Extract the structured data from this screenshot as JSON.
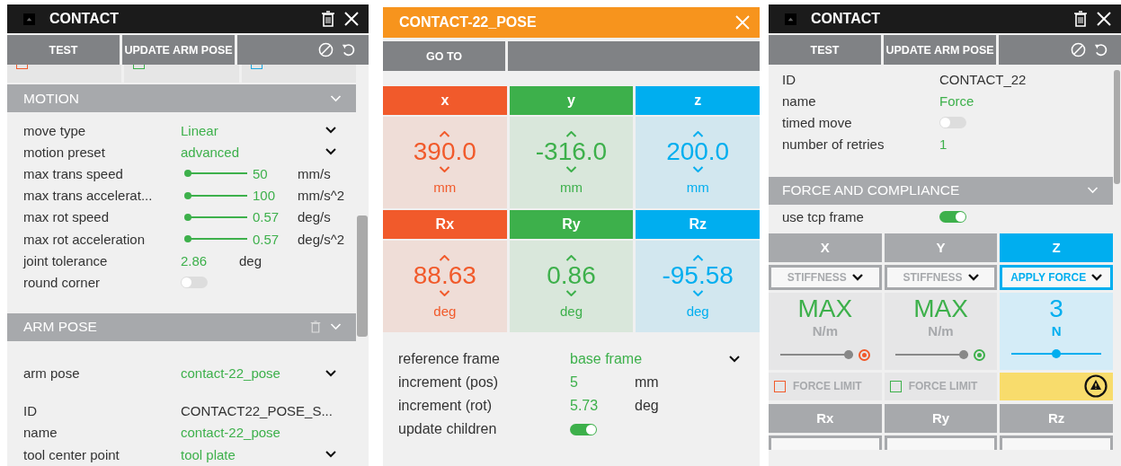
{
  "left_panel": {
    "title": "CONTACT",
    "buttons": [
      "TEST",
      "UPDATE ARM POSE"
    ],
    "limit_strip": [
      {
        "color": "#f15a2b",
        "checked": false
      },
      {
        "color": "#3db04b",
        "checked": false
      },
      {
        "color": "#1ea7e0",
        "checked": false
      }
    ],
    "motion": {
      "title": "MOTION",
      "rows": [
        {
          "kind": "dropdown",
          "label": "move type",
          "value": "Linear"
        },
        {
          "kind": "dropdown",
          "label": "motion preset",
          "value": "advanced"
        },
        {
          "kind": "slider",
          "label": "max trans speed",
          "level": 0,
          "value": "50",
          "unit": "mm/s"
        },
        {
          "kind": "slider",
          "label": "max trans accelerat...",
          "level": 0,
          "value": "100",
          "unit": "mm/s^2"
        },
        {
          "kind": "slider",
          "label": "max rot speed",
          "level": 0,
          "value": "0.57",
          "unit": "deg/s"
        },
        {
          "kind": "slider",
          "label": "max rot acceleration",
          "level": 0,
          "value": "0.57",
          "unit": "deg/s^2"
        },
        {
          "kind": "number",
          "label": "joint tolerance",
          "value": "2.86",
          "unit": "deg"
        },
        {
          "kind": "toggle",
          "label": "round corner",
          "on": false
        }
      ]
    },
    "arm_pose": {
      "title": "ARM POSE",
      "rows": [
        {
          "kind": "dropdown",
          "label": "arm pose",
          "value": "contact-22_pose"
        }
      ],
      "detail_rows": [
        {
          "kind": "text",
          "label": "ID",
          "value": "CONTACT22_POSE_S..."
        },
        {
          "kind": "number",
          "label": "name",
          "value": "contact-22_pose"
        },
        {
          "kind": "dropdown",
          "label": "tool center point",
          "value": "tool plate"
        }
      ]
    }
  },
  "pose_panel": {
    "title": "CONTACT-22_POSE",
    "buttons": [
      "GO TO"
    ],
    "axes": [
      {
        "label": "x",
        "value": "390.0",
        "unit": "mm",
        "color": "#f15a2b"
      },
      {
        "label": "y",
        "value": "-316.0",
        "unit": "mm",
        "color": "#3db04b"
      },
      {
        "label": "z",
        "value": "200.0",
        "unit": "mm",
        "color": "#00aeef"
      },
      {
        "label": "Rx",
        "value": "88.63",
        "unit": "deg",
        "color": "#f15a2b"
      },
      {
        "label": "Ry",
        "value": "0.86",
        "unit": "deg",
        "color": "#3db04b"
      },
      {
        "label": "Rz",
        "value": "-95.58",
        "unit": "deg",
        "color": "#00aeef"
      }
    ],
    "rows": [
      {
        "kind": "dropdown",
        "label": "reference frame",
        "value": "base frame"
      },
      {
        "kind": "number",
        "label": "increment (pos)",
        "value": "5",
        "unit": "mm"
      },
      {
        "kind": "number",
        "label": "increment (rot)",
        "value": "5.73",
        "unit": "deg"
      },
      {
        "kind": "toggle",
        "label": "update children",
        "on": true
      }
    ]
  },
  "contact_panel": {
    "title": "CONTACT",
    "buttons": [
      "TEST",
      "UPDATE ARM POSE"
    ],
    "rows": [
      {
        "kind": "text",
        "label": "ID",
        "value": "CONTACT_22"
      },
      {
        "kind": "number",
        "label": "name",
        "value": "Force"
      },
      {
        "kind": "toggle",
        "label": "timed move",
        "on": false
      },
      {
        "kind": "number",
        "label": "number of retries",
        "value": "1"
      }
    ],
    "force": {
      "title": "FORCE AND COMPLIANCE",
      "rows": [
        {
          "kind": "toggle",
          "label": "use tcp frame",
          "on": true
        }
      ],
      "axes": [
        {
          "label": "X",
          "selected": false,
          "mode": "STIFFNESS",
          "value": "MAX",
          "unit": "N/m",
          "level": 1,
          "color": "#f15a2b",
          "limit": {
            "kind": "checkbox",
            "label": "FORCE LIMIT",
            "checked": false
          }
        },
        {
          "label": "Y",
          "selected": false,
          "mode": "STIFFNESS",
          "value": "MAX",
          "unit": "N/m",
          "level": 1,
          "color": "#3db04b",
          "limit": {
            "kind": "checkbox",
            "label": "FORCE LIMIT",
            "checked": false
          }
        },
        {
          "label": "Z",
          "selected": true,
          "mode": "APPLY FORCE",
          "value": "3",
          "unit": "N",
          "level": 0.5,
          "color": "#00aeef",
          "limit": {
            "kind": "warning"
          }
        }
      ],
      "rot_axes": [
        {
          "label": "Rx"
        },
        {
          "label": "Ry"
        },
        {
          "label": "Rz"
        }
      ]
    }
  }
}
